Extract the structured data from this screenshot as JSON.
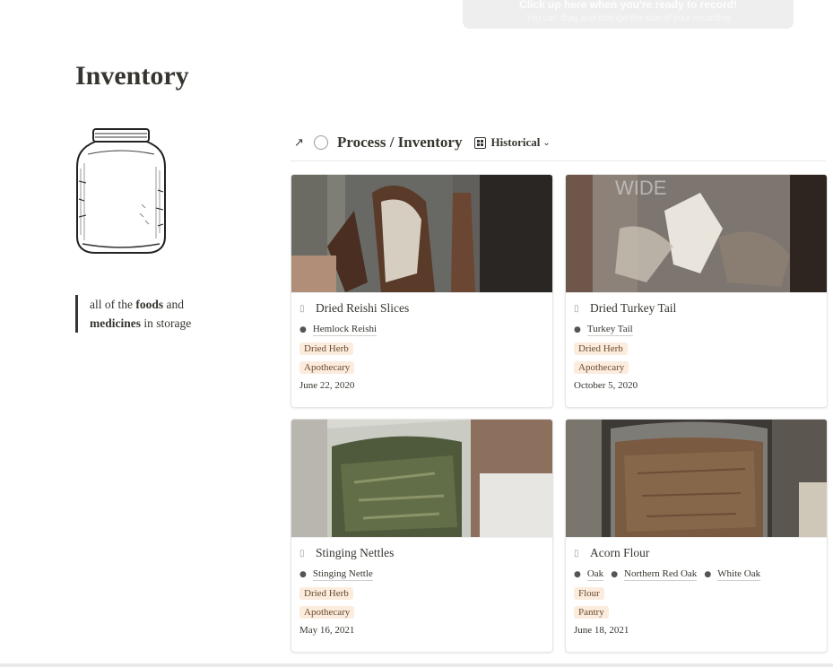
{
  "recording_banner": {
    "line1": "Click up here when you're ready to record!",
    "line2": "You can drag and change the size of your recording"
  },
  "page": {
    "title": "Inventory"
  },
  "callout": {
    "parts": [
      {
        "text": "all of the ",
        "bold": false
      },
      {
        "text": "foods",
        "bold": true
      },
      {
        "text": " and",
        "bold": false
      },
      {
        "text": "medicines",
        "bold": true
      },
      {
        "text": " in storage",
        "bold": false
      }
    ]
  },
  "database": {
    "title": "Process / Inventory",
    "view_label": "Historical",
    "icons": {
      "open": "arrow-up-right-icon",
      "db": "circle-icon",
      "view": "gallery-icon"
    }
  },
  "cards": [
    {
      "title": "Dried Reishi Slices",
      "relations": [
        "Hemlock Reishi"
      ],
      "tags": [
        "Dried Herb",
        "Apothecary"
      ],
      "date": "June 22, 2020",
      "image": "reishi-jar"
    },
    {
      "title": "Dried Turkey Tail",
      "relations": [
        "Turkey Tail"
      ],
      "tags": [
        "Dried Herb",
        "Apothecary"
      ],
      "date": "October 5, 2020",
      "image": "turkey-tail-jar"
    },
    {
      "title": "Stinging Nettles",
      "relations": [
        "Stinging Nettle"
      ],
      "tags": [
        "Dried Herb",
        "Apothecary"
      ],
      "date": "May 16, 2021",
      "image": "nettle-jar"
    },
    {
      "title": "Acorn Flour",
      "relations": [
        "Oak",
        "Northern Red Oak",
        "White Oak"
      ],
      "tags": [
        "Flour",
        "Pantry"
      ],
      "date": "June 18, 2021",
      "image": "acorn-flour-jar"
    }
  ],
  "colors": {
    "tag_bg": "#fbecdd",
    "tag_text": "#6b4a2e",
    "text": "#37352f"
  }
}
